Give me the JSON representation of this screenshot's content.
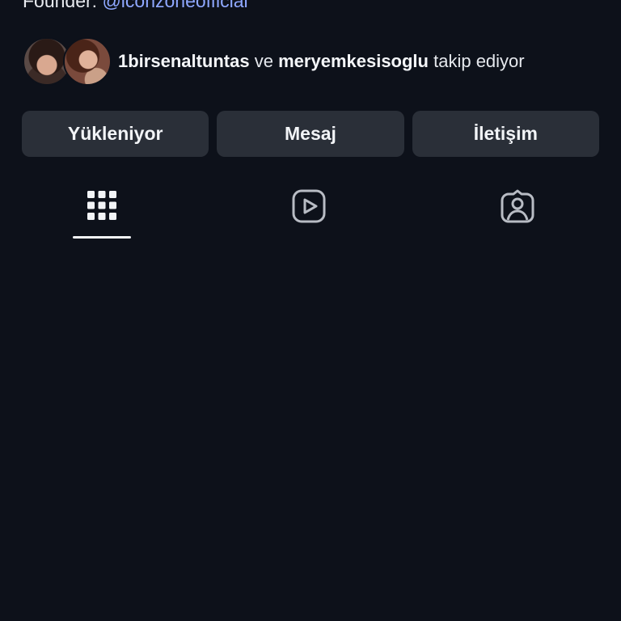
{
  "bio": {
    "label": "Founder:",
    "mention": "@iconzoneofficial"
  },
  "followed_by": {
    "user1": "1birsenaltuntas",
    "connector": "ve",
    "user2": "meryemkesisoglu",
    "suffix": "takip ediyor"
  },
  "actions": {
    "follow_label": "Yükleniyor",
    "message_label": "Mesaj",
    "contact_label": "İletişim"
  },
  "tabs": {
    "items": [
      {
        "icon": "grid-icon",
        "selected": true
      },
      {
        "icon": "reels-icon",
        "selected": false
      },
      {
        "icon": "tagged-icon",
        "selected": false
      }
    ]
  },
  "colors": {
    "background": "#0d111a",
    "button": "#2a2f38",
    "mention": "#8fa8ff",
    "text": "#f2f4f7",
    "icon_inactive": "#b8bcc4"
  }
}
